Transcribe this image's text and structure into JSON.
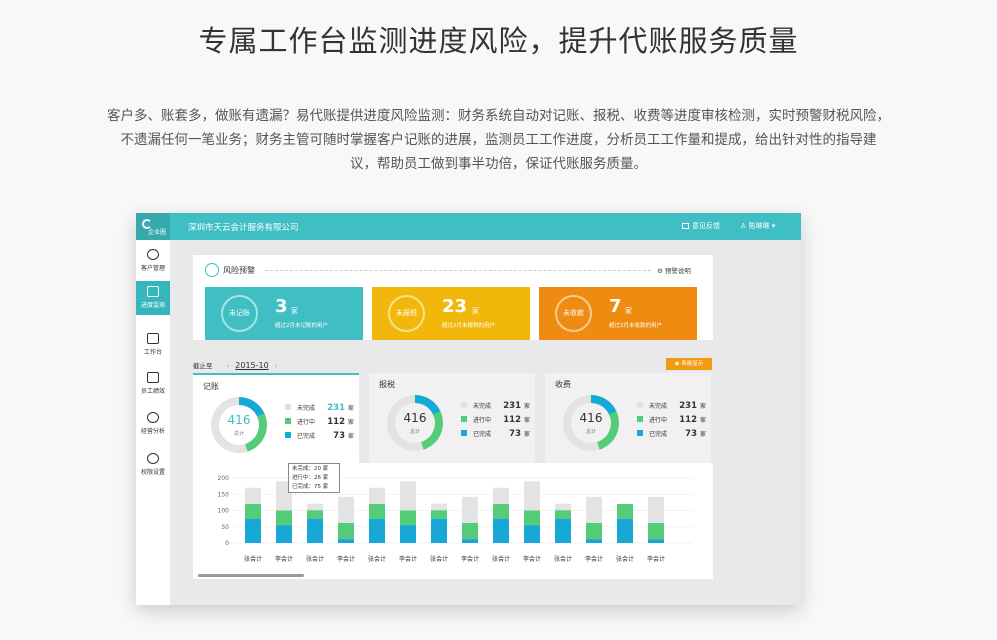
{
  "headline": "专属工作台监测进度风险，提升代账服务质量",
  "intro": [
    "客户多、账套多，做账有遗漏？易代账提供进度风险监测：财务系统自动对记账、报税、收费等进度审核检测，实时预警财税风险，",
    "不遗漏任何一笔业务；财务主管可随时掌握客户记账的进展，监测员工工作进度，分析员工工作量和提成，给出针对性的指导建",
    "议，帮助员工做到事半功倍，保证代账服务质量。"
  ],
  "app": {
    "logo_text": "企业圈",
    "company": "深圳市天云会计服务有限公司",
    "feedback": "意见反馈",
    "user": "陈琳琳 ▾",
    "colors": {
      "teal": "#3fbec3",
      "yellow": "#f1b80b",
      "orange": "#ee8b10",
      "gray": "#e3e3e3",
      "green": "#54cc78",
      "blue": "#18a8d5"
    }
  },
  "sidebar": {
    "items": [
      {
        "label": "客户管理",
        "icon": "user-icon"
      },
      {
        "label": "进度监测",
        "icon": "chart-image-icon"
      },
      {
        "label": "工作台",
        "icon": "monitor-icon"
      },
      {
        "label": "员工绩效",
        "icon": "bar-chart-icon"
      },
      {
        "label": "经营分析",
        "icon": "pie-chart-icon"
      },
      {
        "label": "权限设置",
        "icon": "gear-icon"
      }
    ]
  },
  "risk": {
    "title": "风险预警",
    "help": "⚙ 预警说明",
    "cards": [
      {
        "circle": "未记账",
        "num": "3",
        "unit": "家",
        "desc": "超过2月未记账的用户"
      },
      {
        "circle": "未报税",
        "num": "23",
        "unit": "家",
        "desc": "超过2月未报税的用户"
      },
      {
        "circle": "未收款",
        "num": "7",
        "unit": "家",
        "desc": "超过2月未收款的用户"
      }
    ]
  },
  "period": {
    "label": "截止至",
    "prev": "‹",
    "value": "2015-10",
    "next": "›"
  },
  "table_btn": "◉ 表格显示",
  "tabs": [
    {
      "title": "记账",
      "total": "416",
      "total_label": "总计",
      "legend": [
        [
          "未完成",
          "231",
          "家"
        ],
        [
          "进行中",
          "112",
          "家"
        ],
        [
          "已完成",
          "73",
          "家"
        ]
      ]
    },
    {
      "title": "报税",
      "total": "416",
      "total_label": "总计",
      "legend": [
        [
          "未完成",
          "231",
          "家"
        ],
        [
          "进行中",
          "112",
          "家"
        ],
        [
          "已完成",
          "73",
          "家"
        ]
      ]
    },
    {
      "title": "收费",
      "total": "416",
      "total_label": "总计",
      "legend": [
        [
          "未完成",
          "231",
          "家"
        ],
        [
          "进行中",
          "112",
          "家"
        ],
        [
          "已完成",
          "73",
          "家"
        ]
      ]
    }
  ],
  "tooltip": [
    "未完成：20 家",
    "进行中：26 家",
    "已完成：75 家"
  ],
  "chart_data": {
    "type": "bar",
    "stacked": true,
    "ylim": [
      0,
      200
    ],
    "yticks": [
      0,
      50,
      100,
      150,
      200
    ],
    "categories": [
      "张会计",
      "李会计",
      "张会计",
      "李会计",
      "张会计",
      "李会计",
      "张会计",
      "李会计",
      "张会计",
      "李会计",
      "张会计",
      "李会计",
      "张会计",
      "李会计"
    ],
    "series": [
      {
        "name": "已完成",
        "color": "#18a8d5",
        "values": [
          75,
          55,
          75,
          12,
          75,
          55,
          75,
          12,
          75,
          55,
          75,
          12,
          75,
          12
        ]
      },
      {
        "name": "进行中",
        "color": "#54cc78",
        "values": [
          45,
          45,
          26,
          50,
          45,
          45,
          26,
          50,
          45,
          45,
          26,
          50,
          45,
          50
        ]
      },
      {
        "name": "未完成",
        "color": "#e3e3e3",
        "values": [
          50,
          90,
          20,
          80,
          50,
          90,
          20,
          80,
          50,
          90,
          20,
          80,
          0,
          80
        ]
      }
    ]
  }
}
